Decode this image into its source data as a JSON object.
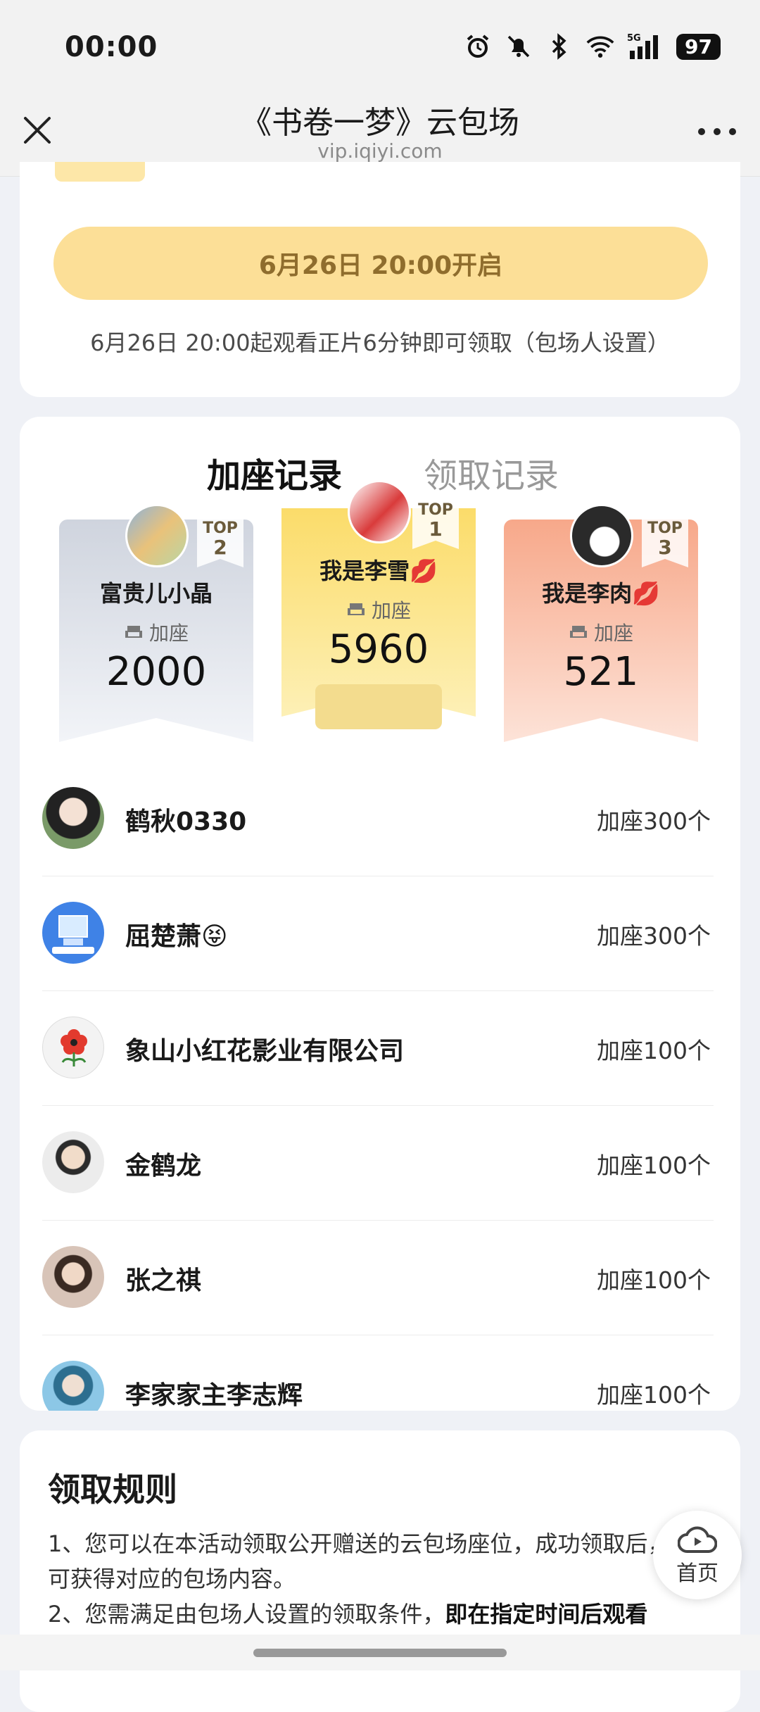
{
  "status_bar": {
    "time": "00:00",
    "network": "5G",
    "battery": "97",
    "icons": [
      "alarm-icon",
      "bell-muted-icon",
      "bluetooth-icon",
      "wifi-icon",
      "signal-icon"
    ]
  },
  "nav": {
    "title": "《书卷一梦》云包场",
    "subtitle": "vip.iqiyi.com"
  },
  "activity": {
    "button_label": "6月26日 20:00开启",
    "note": "6月26日 20:00起观看正片6分钟即可领取（包场人设置）"
  },
  "records": {
    "tabs": [
      {
        "label": "加座记录",
        "active": true
      },
      {
        "label": "领取记录",
        "active": false
      }
    ],
    "seat_label": "加座",
    "podium": [
      {
        "rank_top": "TOP",
        "rank_num": "2",
        "name": "富贵儿小晶",
        "count": "2000",
        "color": "#d7dbe4"
      },
      {
        "rank_top": "TOP",
        "rank_num": "1",
        "name": "我是李雪💋",
        "count": "5960",
        "color": "#fbe27d"
      },
      {
        "rank_top": "TOP",
        "rank_num": "3",
        "name": "我是李肉💋",
        "count": "521",
        "color": "#f9b8a0"
      }
    ],
    "list": [
      {
        "name": "鹤秋0330",
        "count": "加座300个",
        "avatar_color": "#6b8a5a"
      },
      {
        "name": "屈楚萧😝",
        "count": "加座300个",
        "avatar_color": "#3a7de0"
      },
      {
        "name": "象山小红花影业有限公司",
        "count": "加座100个",
        "avatar_color": "#f2f2f2"
      },
      {
        "name": "金鹤龙",
        "count": "加座100个",
        "avatar_color": "#e4e4e4"
      },
      {
        "name": "张之祺",
        "count": "加座100个",
        "avatar_color": "#cdb7a8"
      },
      {
        "name": "李家家主李志辉",
        "count": "加座100个",
        "avatar_color": "#4aa3c7"
      }
    ]
  },
  "rules": {
    "title": "领取规则",
    "line1": "1、您可以在本活动领取公开赠送的云包场座位，成功领取后，可获得对应的包场内容。",
    "line2_prefix": "2、您需满足由包场人设置的领取条件，",
    "line2_bold": "即在指定时间后观看"
  },
  "float_home": {
    "label": "首页"
  }
}
